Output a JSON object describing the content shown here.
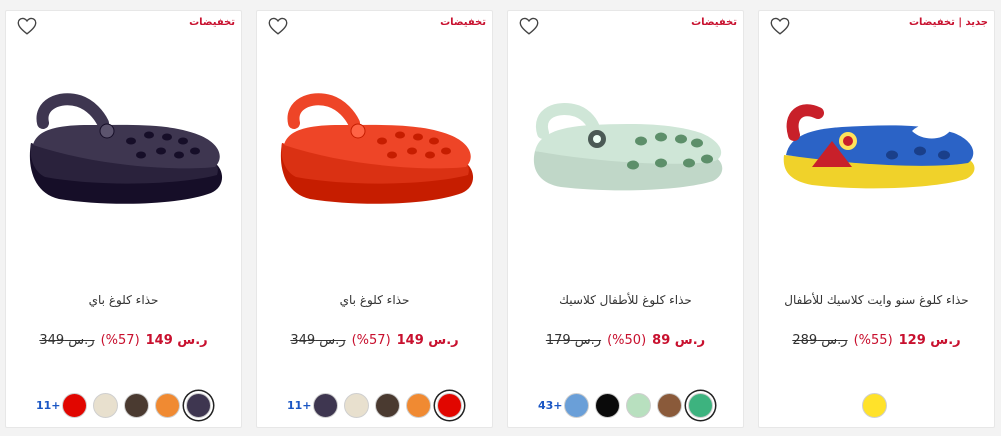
{
  "cards": [
    {
      "badge": "تخفيضات",
      "name": "حذاء كلوغ باي",
      "price_now": "ر.س 149",
      "discount": "(57%)",
      "price_was": "ر.س 349",
      "more_colors": "11+",
      "swatches": [
        "#e10600",
        "#e8e0ce",
        "#4a3a30",
        "#f08a32",
        "#3e3650"
      ],
      "selected": 4,
      "shoe_color": "#3e3650",
      "shoe_style": "platform"
    },
    {
      "badge": "تخفيضات",
      "name": "حذاء كلوغ باي",
      "price_now": "ر.س 149",
      "discount": "(57%)",
      "price_was": "ر.س 349",
      "more_colors": "11+",
      "swatches": [
        "#3e3650",
        "#e8e0ce",
        "#4a3a30",
        "#f08a32",
        "#e10600"
      ],
      "selected": 4,
      "shoe_color": "#ee4527",
      "shoe_style": "platform"
    },
    {
      "badge": "تخفيضات",
      "name": "حذاء كلوغ للأطفال كلاسيك",
      "price_now": "ر.س 89",
      "discount": "(50%)",
      "price_was": "ر.س 179",
      "more_colors": "43+",
      "swatches": [
        "#6a9fd8",
        "#0a0a0a",
        "#b8e0bf",
        "#8a5a3a",
        "#3db37f"
      ],
      "selected": 4,
      "shoe_color": "#cfe6d7",
      "shoe_style": "classic"
    },
    {
      "badge": "جديد | تخفيضات",
      "name": "حذاء كلوغ سنو وايت كلاسيك للأطفال",
      "price_now": "ر.س 129",
      "discount": "(55%)",
      "price_was": "ر.س 289",
      "more_colors": "",
      "swatches": [
        "#ffe22a"
      ],
      "selected": -1,
      "shoe_color": "#2b63c6",
      "shoe_style": "snowwhite"
    }
  ],
  "icons": {
    "wishlist": "heart-outline-icon"
  }
}
